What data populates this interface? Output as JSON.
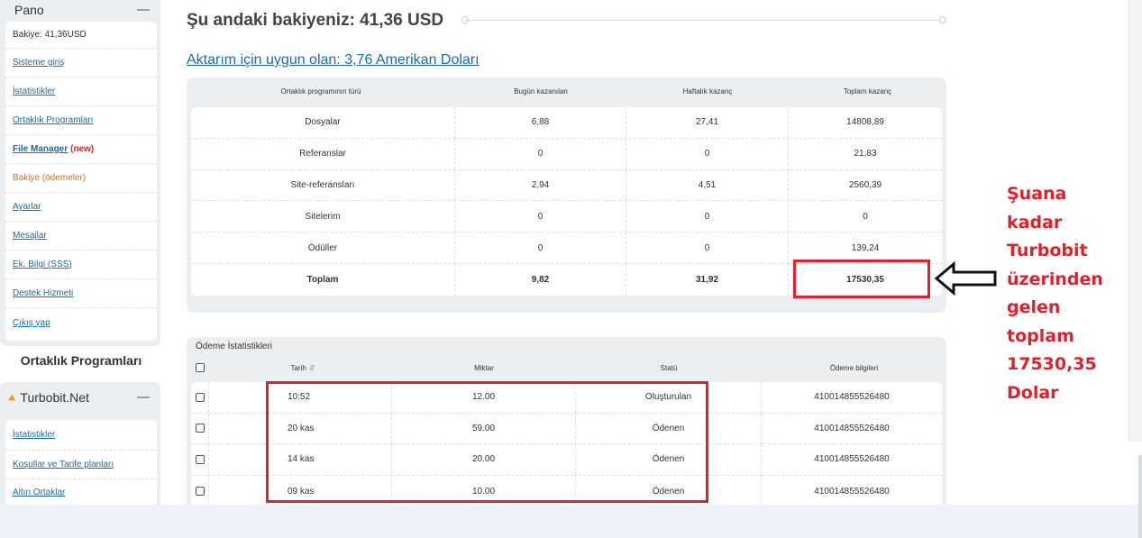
{
  "sidebar": {
    "pano_title": "Pano",
    "balance": "Bakiye: 41,36USD",
    "items": [
      {
        "label": "Sisteme giriş"
      },
      {
        "label": "İstatistikler"
      },
      {
        "label": "Ortaklık Programları"
      },
      {
        "label": "File Manager",
        "badge": "(new)"
      },
      {
        "label": "Bakiye (ödemeler)"
      },
      {
        "label": "Ayarlar"
      },
      {
        "label": "Mesajlar"
      },
      {
        "label": "Ek. Bilgi (SSS)"
      },
      {
        "label": "Destek Hizmeti"
      },
      {
        "label": "Çıkış yap"
      }
    ],
    "section_title": "Ortaklık Programları",
    "turbobit": {
      "title": "Turbobit.Net",
      "items": [
        {
          "label": "İstatistikler"
        },
        {
          "label": "Koşullar ve Tarife planları"
        },
        {
          "label": "Altın Ortaklar"
        }
      ]
    }
  },
  "main": {
    "balance_title": "Şu andaki bakiyeniz: 41,36 USD",
    "transfer_link": "Aktarım için uygun olan: 3,76 Amerikan Doları",
    "earnings_table": {
      "headers": [
        "Ortaklık programının türü",
        "Bugün kazanılan",
        "Haftalık kazanç",
        "Toplam kazanç"
      ],
      "rows": [
        [
          "Dosyalar",
          "6,88",
          "27,41",
          "14808,89"
        ],
        [
          "Referanslar",
          "0",
          "0",
          "21,83"
        ],
        [
          "Site-referansları",
          "2,94",
          "4,51",
          "2560,39"
        ],
        [
          "Sitelerim",
          "0",
          "0",
          "0"
        ],
        [
          "Ödüller",
          "0",
          "0",
          "139,24"
        ],
        [
          "Toplam",
          "9,82",
          "31,92",
          "17530,35"
        ]
      ]
    },
    "payments": {
      "title": "Ödeme İstatistikleri",
      "headers": [
        "Tarih",
        "Miktar",
        "Statü",
        "Ödeme bilgileri"
      ],
      "rows": [
        [
          "10:52",
          "12.00",
          "Oluşturulan",
          "410014855526480"
        ],
        [
          "20 kas",
          "59.00",
          "Ödenen",
          "410014855526480"
        ],
        [
          "14 kas",
          "20.00",
          "Ödenen",
          "410014855526480"
        ],
        [
          "09 kas",
          "10.00",
          "Ödenen",
          "410014855526480"
        ]
      ]
    }
  },
  "annotation": {
    "lines": [
      "Şuana",
      "kadar",
      "Turbobit",
      "üzerinden",
      "gelen",
      "toplam",
      "17530,35",
      "Dolar"
    ],
    "color": "#e3202a"
  }
}
